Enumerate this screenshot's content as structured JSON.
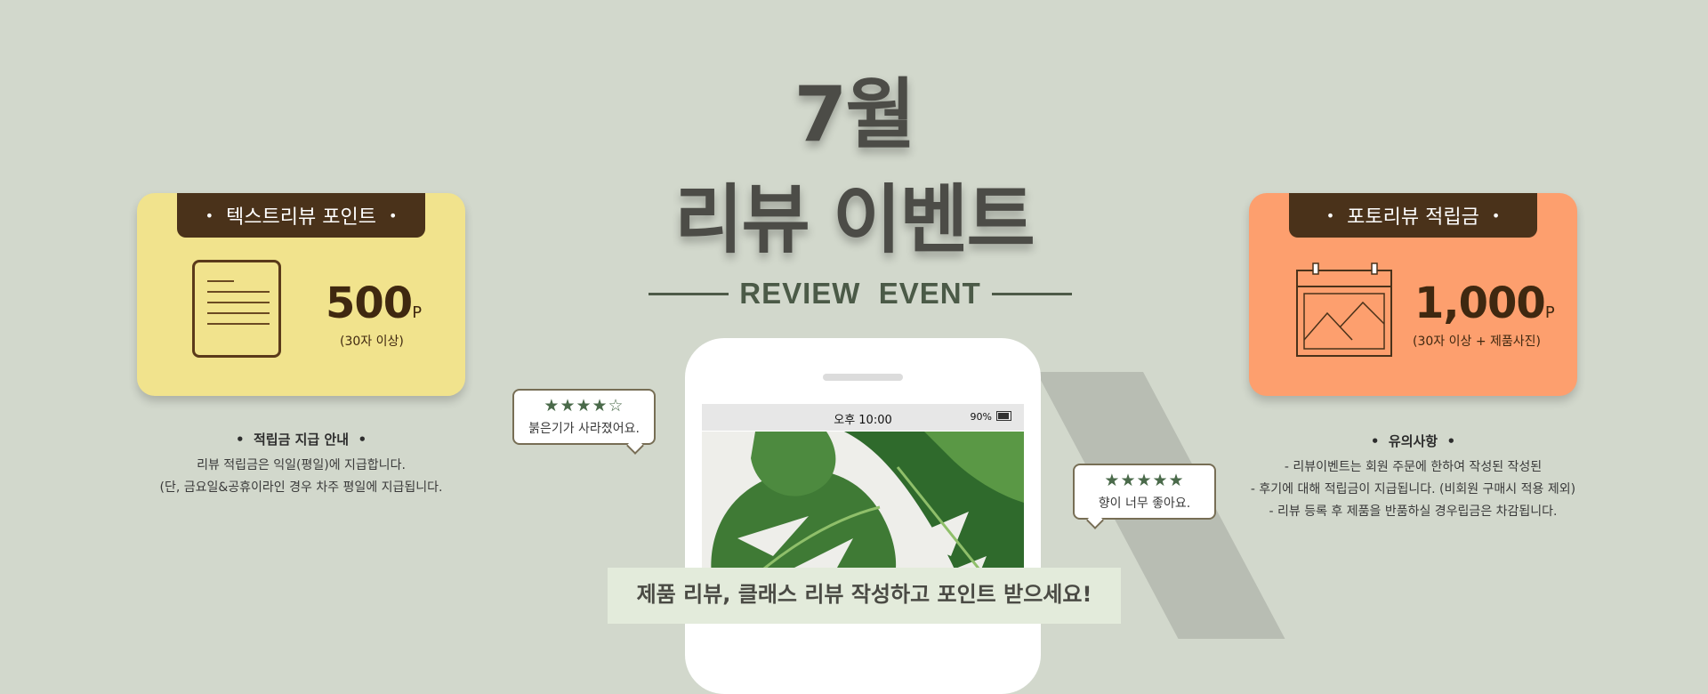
{
  "hero": {
    "month": "7월",
    "title": "리뷰 이벤트",
    "subtitle": "REVIEW  EVENT"
  },
  "left_card": {
    "header": "텍스트리뷰 포인트",
    "dot": "•",
    "icon": "document-icon",
    "amount": "500",
    "unit": "P",
    "note": "(30자 이상)",
    "color": "#f1e38d"
  },
  "right_card": {
    "header": "포토리뷰 적립금",
    "dot": "•",
    "icon": "photo-frame-icon",
    "amount": "1,000",
    "unit": "P",
    "note": "(30자 이상 + 제품사진)",
    "color": "#fd9f6e"
  },
  "left_info": {
    "title": "•  적립금 지급 안내  •",
    "lines": [
      "리뷰 적립금은  익일(평일)에 지급합니다.",
      "(단,  금요일&공휴이라인 경우 차주 평일에 지급됩니다."
    ]
  },
  "right_info": {
    "title": "•  유의사항  •",
    "lines": [
      "- 리뷰이벤트는 회원 주문에 한하여 작성된 작성된",
      "- 후기에 대해 적립금이 지급됩니다. (비회원 구매시 적용 제외)",
      "- 리뷰 등록 후 제품을 반품하실 경우립금은 차감됩니다."
    ]
  },
  "phone": {
    "time": "오후 10:00",
    "battery": "90%"
  },
  "bubbles": [
    {
      "stars": "★★★★☆",
      "rating": 4,
      "text": "붉은기가 사라졌어요."
    },
    {
      "stars": "★★★★★",
      "rating": 5,
      "text": "향이 너무 좋아요."
    }
  ],
  "banner": {
    "text": "제품 리뷰, 클래스 리뷰 작성하고 포인트 받으세요!"
  },
  "colors": {
    "background": "#d2d8cc",
    "header_brown": "#4a321a",
    "accent_green": "#4b5a47"
  }
}
